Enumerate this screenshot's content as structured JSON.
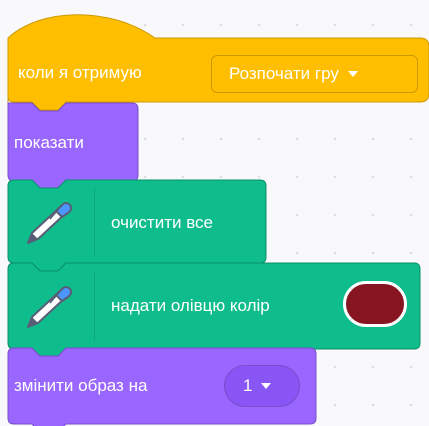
{
  "blocks": {
    "hat": {
      "prefix": "коли я отримую",
      "message": "Розпочати гру",
      "color": "#ffbf00",
      "border": "#cc9900"
    },
    "show": {
      "label": "показати",
      "color": "#9966ff",
      "border": "#774dcb"
    },
    "clear": {
      "label": "очистити все",
      "icon": "pen-icon",
      "color": "#0fbd8c",
      "border": "#0b8e69"
    },
    "set_color": {
      "label": "надати олівцю колір",
      "icon": "pen-icon",
      "swatch": "#861520",
      "color": "#0fbd8c"
    },
    "costume": {
      "label": "змінити образ на",
      "value": "1",
      "color": "#9966ff"
    }
  }
}
